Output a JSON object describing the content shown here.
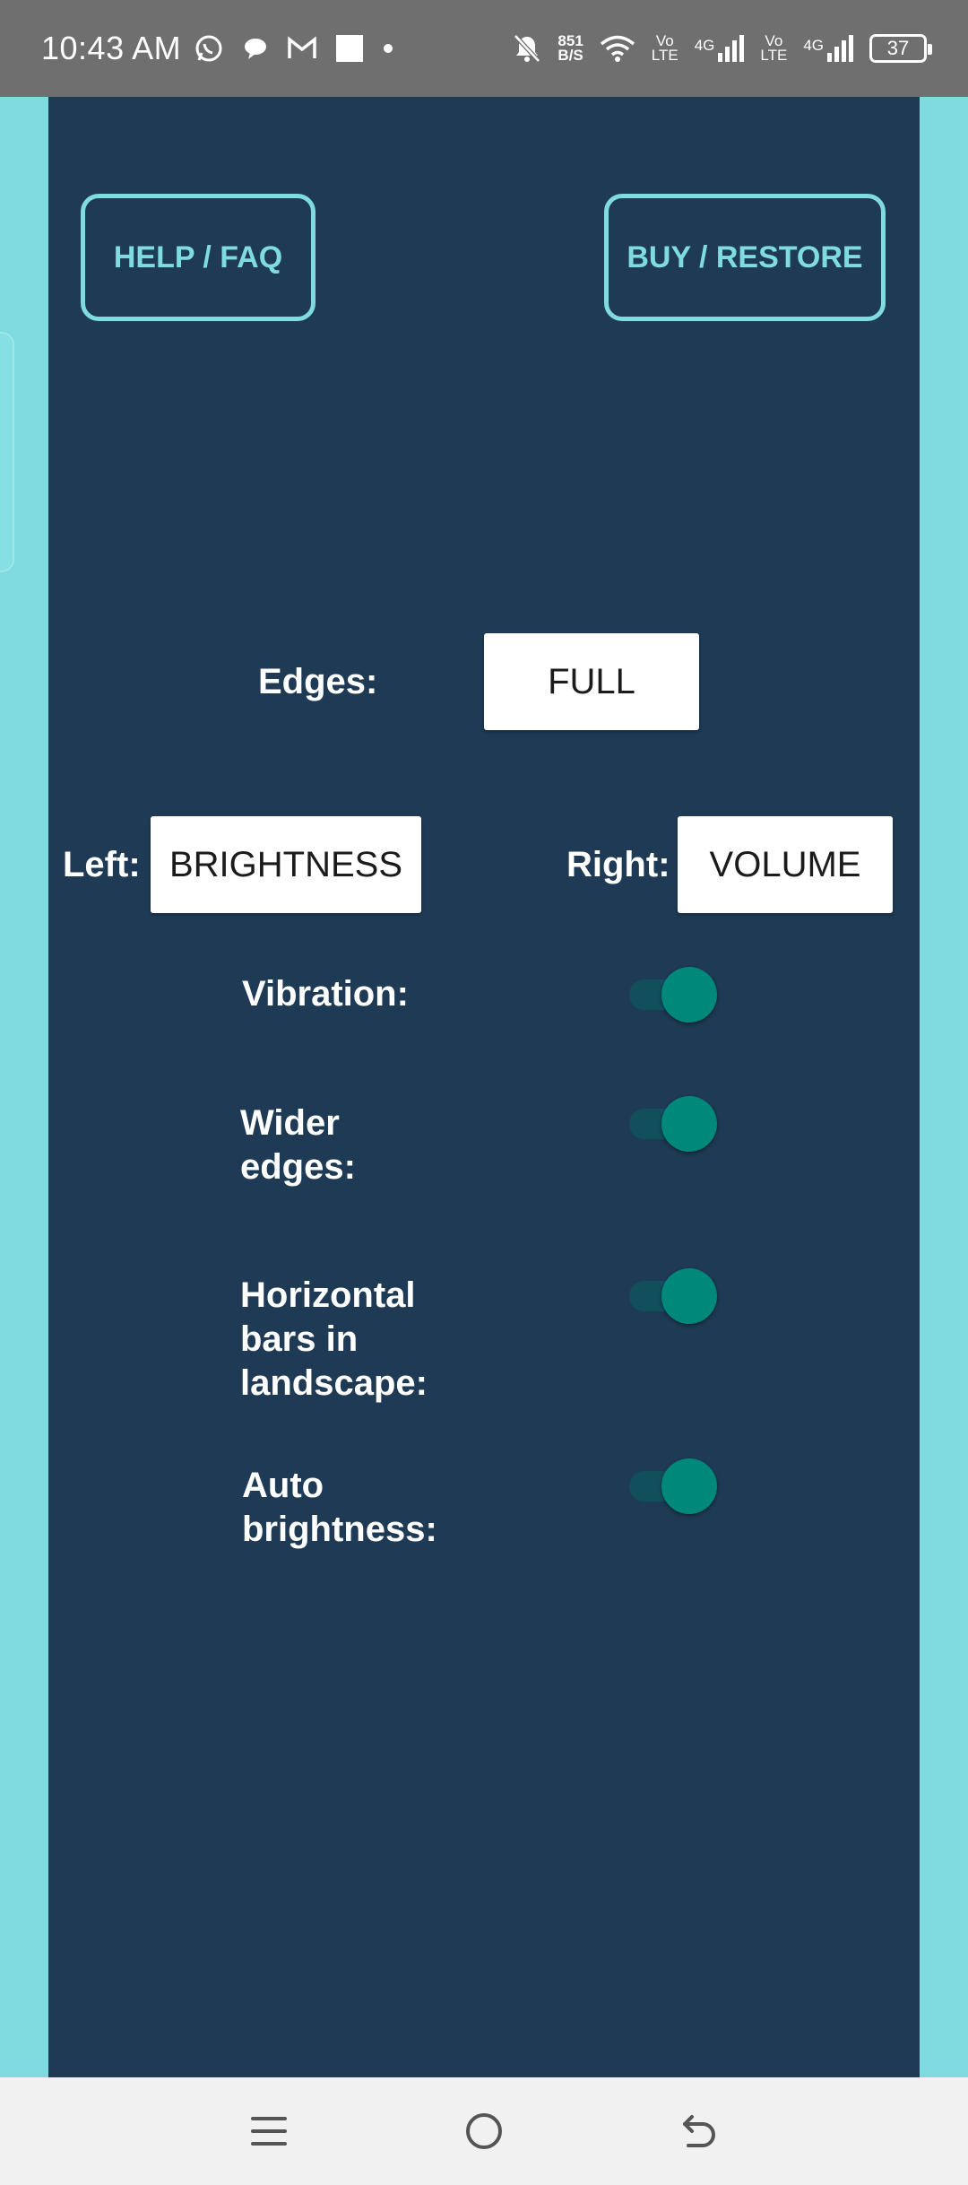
{
  "status_bar": {
    "time": "10:43 AM",
    "net_speed_value": "851",
    "net_speed_unit": "B/S",
    "volte_top": "Vo",
    "volte_bottom": "LTE",
    "sim1_label": "4G",
    "sim2_label": "4G",
    "battery": "37",
    "icons": [
      "whatsapp-icon",
      "chat-icon",
      "gmail-icon",
      "square-icon",
      "dot-icon",
      "bell-off-icon",
      "wifi-icon",
      "signal-icon",
      "battery-icon"
    ]
  },
  "buttons": {
    "help": "HELP / FAQ",
    "buy": "BUY / RESTORE"
  },
  "edges": {
    "label": "Edges:",
    "value": "FULL"
  },
  "left": {
    "label": "Left:",
    "value": "BRIGHTNESS"
  },
  "right": {
    "label": "Right:",
    "value": "VOLUME"
  },
  "toggles": [
    {
      "label": "Vibration:",
      "on": true
    },
    {
      "label": "Wider edges:",
      "on": true
    },
    {
      "label": "Horizontal bars in landscape:",
      "on": true
    },
    {
      "label": "Auto brightness:",
      "on": true
    }
  ],
  "nav": {
    "icons": [
      "menu-icon",
      "home-icon",
      "back-icon"
    ]
  },
  "colors": {
    "panel": "#1e3a54",
    "accent": "#7fdbe0",
    "toggle_on": "#00897b"
  }
}
